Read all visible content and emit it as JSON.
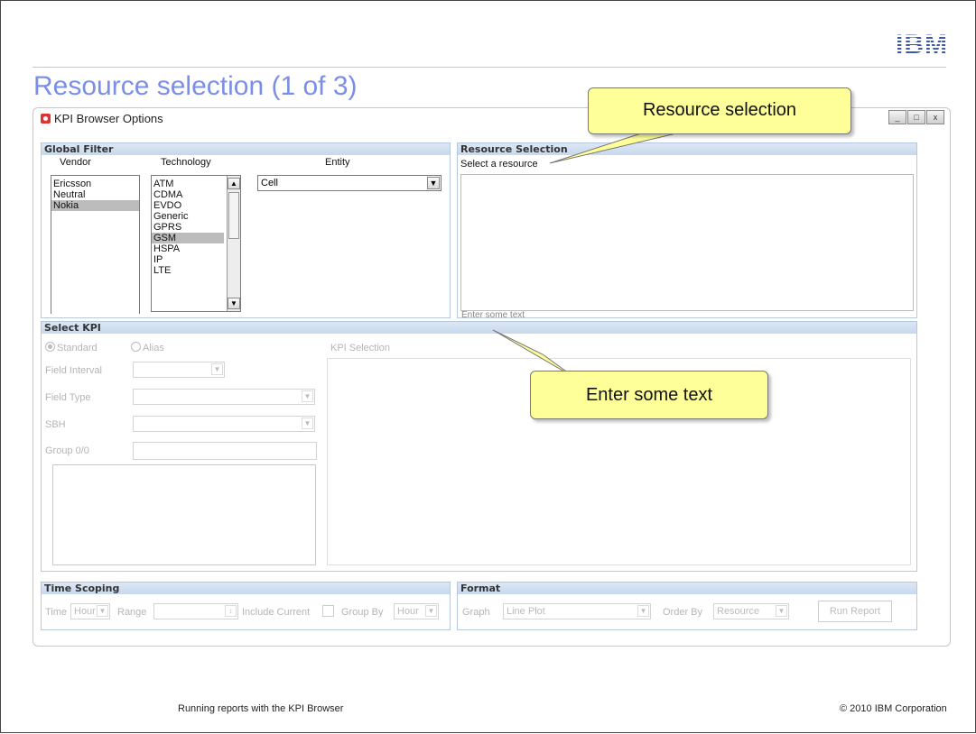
{
  "slide": {
    "logo": "IBM",
    "title": "Resource selection (1 of 3)",
    "footer_left": "Running reports with the KPI Browser",
    "footer_right": "© 2010 IBM Corporation"
  },
  "window": {
    "title": "KPI Browser Options",
    "controls": [
      "minimize-icon",
      "maximize-icon",
      "close-icon"
    ]
  },
  "global_filter": {
    "header": "Global Filter",
    "vendor": {
      "label": "Vendor",
      "items": [
        "Ericsson",
        "Neutral",
        "Nokia"
      ],
      "selected": "Nokia"
    },
    "technology": {
      "label": "Technology",
      "items": [
        "ATM",
        "CDMA",
        "EVDO",
        "Generic",
        "GPRS",
        "GSM",
        "HSPA",
        "IP",
        "LTE"
      ],
      "selected": "GSM"
    },
    "entity": {
      "label": "Entity",
      "value": "Cell"
    }
  },
  "resource_selection": {
    "header": "Resource Selection",
    "prompt": "Select a resource",
    "text_placeholder": "Enter some text"
  },
  "select_kpi": {
    "header": "Select KPI",
    "radio_standard": "Standard",
    "radio_alias": "Alias",
    "selected_radio": "Standard",
    "field_interval": "Field Interval",
    "field_type": "Field Type",
    "sbh": "SBH",
    "group": "Group 0/0",
    "kpi_selection": "KPI Selection"
  },
  "time_scoping": {
    "header": "Time Scoping",
    "time_label": "Time",
    "time_value": "Hour",
    "range_label": "Range",
    "include_current": "Include Current",
    "group_by_label": "Group By",
    "group_by_value": "Hour"
  },
  "format": {
    "header": "Format",
    "graph_label": "Graph",
    "graph_value": "Line Plot",
    "order_by_label": "Order By",
    "order_by_value": "Resource",
    "run_report": "Run Report"
  },
  "callouts": {
    "resource_selection": "Resource selection",
    "enter_text": "Enter some text"
  },
  "colors": {
    "title": "#7b8fe6",
    "panel_header": "#c7d8ee",
    "callout_fill": "#ffff99",
    "selection": "#bcbcbc"
  }
}
